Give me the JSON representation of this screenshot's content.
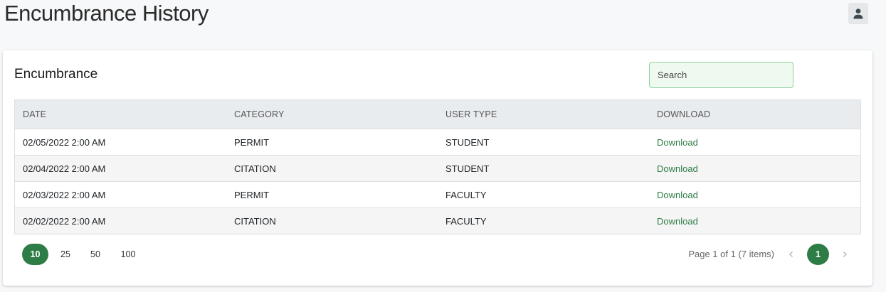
{
  "page": {
    "title": "Encumbrance History"
  },
  "card": {
    "title": "Encumbrance",
    "search_placeholder": "Search"
  },
  "table": {
    "headers": [
      "DATE",
      "CATEGORY",
      "USER TYPE",
      "DOWNLOAD"
    ],
    "rows": [
      {
        "date": "02/05/2022 2:00 AM",
        "category": "PERMIT",
        "user_type": "STUDENT",
        "download": "Download"
      },
      {
        "date": "02/04/2022 2:00 AM",
        "category": "CITATION",
        "user_type": "STUDENT",
        "download": "Download"
      },
      {
        "date": "02/03/2022 2:00 AM",
        "category": "PERMIT",
        "user_type": "FACULTY",
        "download": "Download"
      },
      {
        "date": "02/02/2022 2:00 AM",
        "category": "CITATION",
        "user_type": "FACULTY",
        "download": "Download"
      }
    ]
  },
  "pager": {
    "page_sizes": [
      "10",
      "25",
      "50",
      "100"
    ],
    "active_page_size": "10",
    "info": "Page 1 of 1 (7 items)",
    "current_page": "1"
  },
  "colors": {
    "accent": "#2e7d46",
    "search_border": "#8fd19e"
  },
  "icons": {
    "user": "user-icon",
    "prev": "chevron-left-icon",
    "next": "chevron-right-icon"
  }
}
